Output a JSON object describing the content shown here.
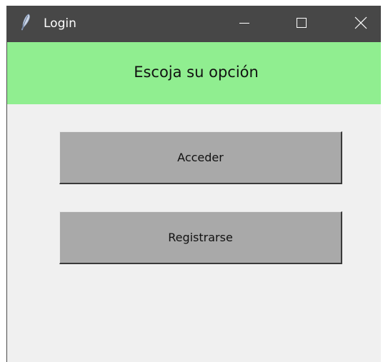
{
  "window": {
    "title": "Login"
  },
  "titlebar": {
    "icons": [
      "feather-icon",
      "minimize-icon",
      "maximize-icon",
      "close-icon"
    ],
    "bg_color": "#474747"
  },
  "header": {
    "text": "Escoja su opción",
    "bg_color": "#90ee90"
  },
  "buttons": {
    "acceder_label": "Acceder",
    "registrarse_label": "Registrarse",
    "bg_color": "#a9a9a9"
  },
  "colors": {
    "window_bg": "#f0f0f0"
  }
}
